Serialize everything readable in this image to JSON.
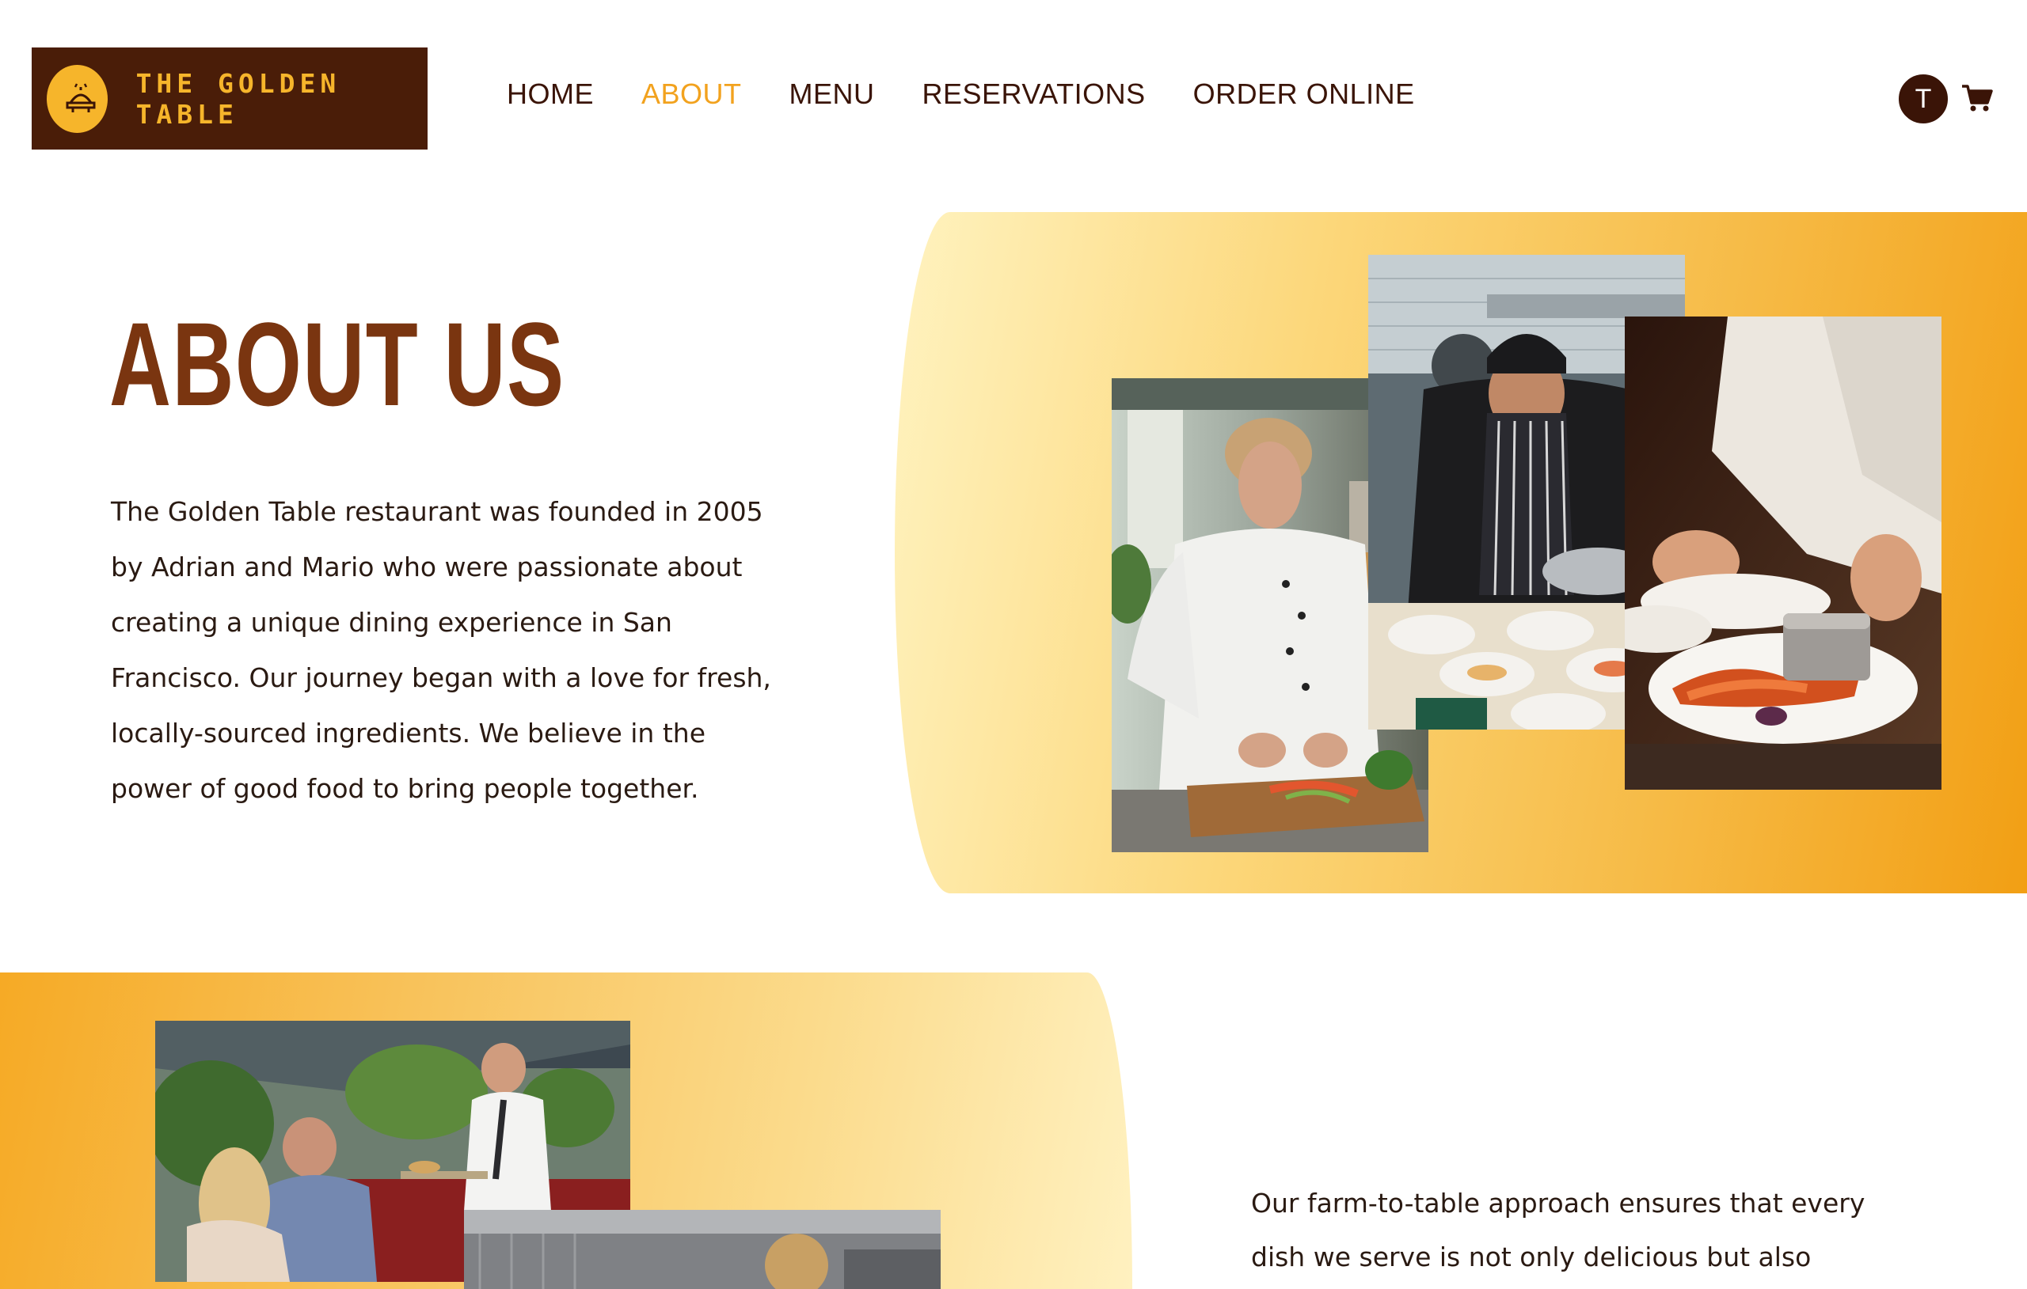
{
  "brand": {
    "name": "THE GOLDEN TABLE"
  },
  "nav": {
    "items": [
      {
        "label": "HOME",
        "active": false
      },
      {
        "label": "ABOUT",
        "active": true
      },
      {
        "label": "MENU",
        "active": false
      },
      {
        "label": "RESERVATIONS",
        "active": false
      },
      {
        "label": "ORDER ONLINE",
        "active": false
      }
    ]
  },
  "user": {
    "initial": "T"
  },
  "icons": {
    "logo": "serving-cloche-icon",
    "cart": "cart-icon"
  },
  "colors": {
    "brand_dark": "#4a1d08",
    "accent": "#f2a21e",
    "title": "#7a3510"
  },
  "about": {
    "title": "ABOUT US",
    "text": "The Golden Table restaurant was founded in 2005 by Adrian and Mario who were passionate about creating a unique dining experience in San Francisco. Our journey began with a love for fresh, locally-sourced ingredients. We believe in the power of good food to bring people together."
  },
  "farm": {
    "text": "Our farm-to-table approach ensures that every dish we serve is not only delicious but also"
  }
}
